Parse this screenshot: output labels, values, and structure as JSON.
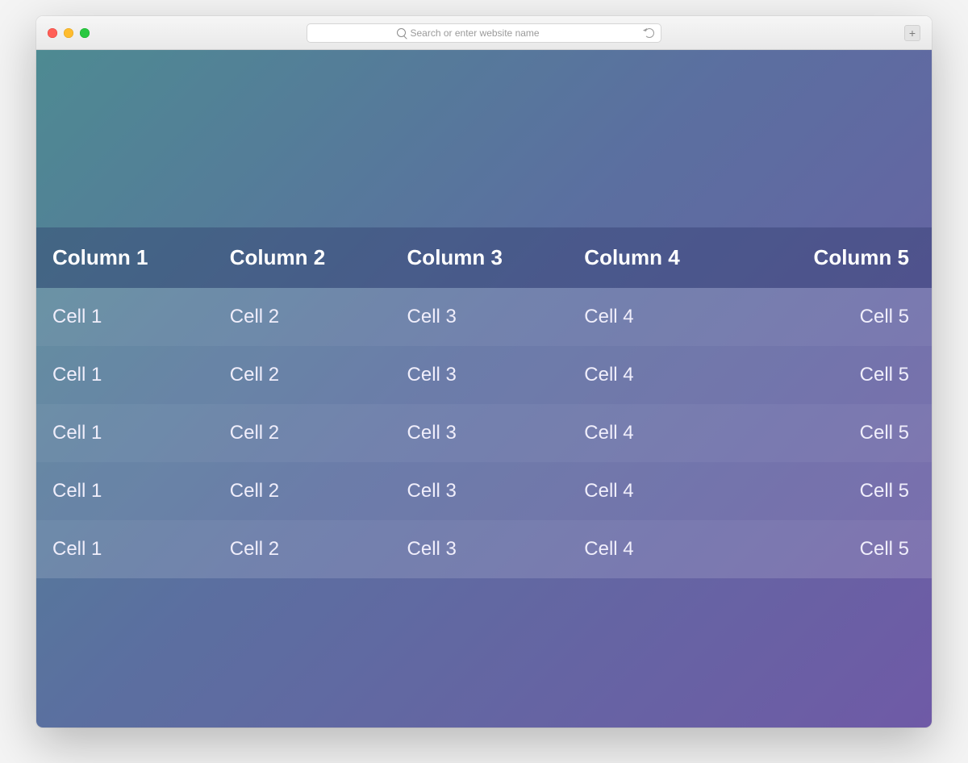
{
  "browser": {
    "address_placeholder": "Search or enter website name",
    "address_value": "",
    "new_tab_label": "+"
  },
  "table": {
    "headers": [
      "Column 1",
      "Column 2",
      "Column 3",
      "Column 4",
      "Column 5"
    ],
    "rows": [
      [
        "Cell 1",
        "Cell 2",
        "Cell 3",
        "Cell 4",
        "Cell 5"
      ],
      [
        "Cell 1",
        "Cell 2",
        "Cell 3",
        "Cell 4",
        "Cell 5"
      ],
      [
        "Cell 1",
        "Cell 2",
        "Cell 3",
        "Cell 4",
        "Cell 5"
      ],
      [
        "Cell 1",
        "Cell 2",
        "Cell 3",
        "Cell 4",
        "Cell 5"
      ],
      [
        "Cell 1",
        "Cell 2",
        "Cell 3",
        "Cell 4",
        "Cell 5"
      ]
    ]
  }
}
